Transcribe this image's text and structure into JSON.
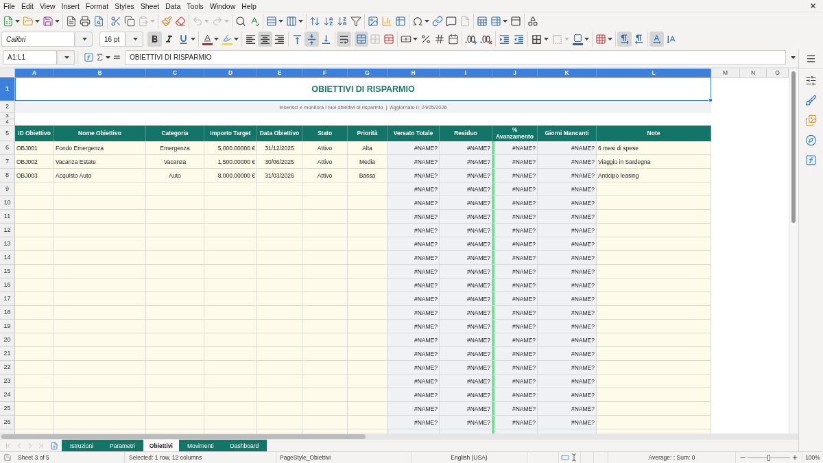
{
  "menu_bar": {
    "items": [
      "File",
      "Edit",
      "View",
      "Insert",
      "Format",
      "Styles",
      "Sheet",
      "Data",
      "Tools",
      "Window",
      "Help"
    ]
  },
  "standard_toolbar": {
    "groups": [
      {
        "buttons": [
          {
            "kind": "new",
            "dropdown": true,
            "disabled": false
          },
          {
            "kind": "open",
            "dropdown": true,
            "disabled": false
          },
          {
            "kind": "save",
            "dropdown": true,
            "disabled": false
          }
        ]
      },
      {
        "buttons": [
          {
            "kind": "pdf",
            "dropdown": false,
            "disabled": false
          },
          {
            "kind": "print",
            "dropdown": false,
            "disabled": false
          },
          {
            "kind": "preview",
            "dropdown": false,
            "disabled": false
          }
        ]
      },
      {
        "buttons": [
          {
            "kind": "cut",
            "dropdown": false,
            "disabled": false
          },
          {
            "kind": "copy",
            "dropdown": false,
            "disabled": false
          },
          {
            "kind": "paste",
            "dropdown": true,
            "disabled": true
          }
        ]
      },
      {
        "buttons": [
          {
            "kind": "clone",
            "dropdown": false,
            "disabled": false
          },
          {
            "kind": "clear",
            "dropdown": false,
            "disabled": false
          }
        ]
      },
      {
        "buttons": [
          {
            "kind": "undo",
            "dropdown": true,
            "disabled": true
          },
          {
            "kind": "redo",
            "dropdown": true,
            "disabled": true
          }
        ]
      },
      {
        "buttons": [
          {
            "kind": "find",
            "dropdown": false,
            "disabled": false
          },
          {
            "kind": "spelling",
            "dropdown": false,
            "disabled": false
          }
        ]
      },
      {
        "buttons": [
          {
            "kind": "rows",
            "dropdown": true,
            "disabled": false
          },
          {
            "kind": "columns",
            "dropdown": true,
            "disabled": false
          }
        ]
      },
      {
        "buttons": [
          {
            "kind": "sort",
            "dropdown": false,
            "disabled": false
          },
          {
            "kind": "ascending",
            "dropdown": false,
            "disabled": false
          },
          {
            "kind": "descending",
            "dropdown": false,
            "disabled": false
          },
          {
            "kind": "autofilter",
            "dropdown": false,
            "disabled": false
          }
        ]
      },
      {
        "buttons": [
          {
            "kind": "image",
            "dropdown": false,
            "disabled": false
          },
          {
            "kind": "chart",
            "dropdown": false,
            "disabled": false
          },
          {
            "kind": "pivot",
            "dropdown": false,
            "disabled": false
          }
        ]
      },
      {
        "buttons": [
          {
            "kind": "symbol",
            "dropdown": true,
            "disabled": false
          },
          {
            "kind": "hyperlink",
            "dropdown": false,
            "disabled": false
          },
          {
            "kind": "comment",
            "dropdown": false,
            "disabled": false
          },
          {
            "kind": "headerfooter",
            "dropdown": false,
            "disabled": true
          }
        ]
      },
      {
        "buttons": [
          {
            "kind": "printarea",
            "dropdown": false,
            "disabled": false
          },
          {
            "kind": "freeze",
            "dropdown": true,
            "disabled": false
          },
          {
            "kind": "split",
            "dropdown": false,
            "disabled": false
          }
        ]
      },
      {
        "buttons": [
          {
            "kind": "shapes",
            "dropdown": false,
            "disabled": false
          }
        ]
      }
    ]
  },
  "formatting_toolbar": {
    "font_name": "Calibri",
    "font_size": "16 pt",
    "groups": [
      {
        "buttons": [
          {
            "kind": "bold",
            "pressed": true,
            "dropdown": false,
            "disabled": false
          },
          {
            "kind": "italic",
            "pressed": false,
            "dropdown": false,
            "disabled": false
          },
          {
            "kind": "underline",
            "pressed": false,
            "dropdown": true,
            "disabled": false
          }
        ]
      },
      {
        "buttons": [
          {
            "kind": "fontcolor",
            "pressed": false,
            "dropdown": true,
            "disabled": false
          },
          {
            "kind": "highlight",
            "pressed": false,
            "dropdown": true,
            "disabled": false
          }
        ]
      },
      {
        "buttons": [
          {
            "kind": "left",
            "pressed": false,
            "dropdown": false,
            "disabled": false
          },
          {
            "kind": "center",
            "pressed": true,
            "dropdown": false,
            "disabled": false
          },
          {
            "kind": "right",
            "pressed": false,
            "dropdown": false,
            "disabled": false
          }
        ]
      },
      {
        "buttons": [
          {
            "kind": "top",
            "pressed": false,
            "dropdown": false,
            "disabled": false
          },
          {
            "kind": "middle",
            "pressed": true,
            "dropdown": false,
            "disabled": false
          },
          {
            "kind": "bottom",
            "pressed": false,
            "dropdown": false,
            "disabled": false
          }
        ]
      },
      {
        "buttons": [
          {
            "kind": "wrap",
            "pressed": true,
            "dropdown": false,
            "disabled": false
          }
        ]
      },
      {
        "buttons": [
          {
            "kind": "mergecenter",
            "pressed": true,
            "dropdown": false,
            "disabled": false
          },
          {
            "kind": "merge",
            "pressed": false,
            "dropdown": false,
            "disabled": true
          },
          {
            "kind": "unmerge",
            "pressed": false,
            "dropdown": false,
            "disabled": false
          }
        ]
      },
      {
        "buttons": [
          {
            "kind": "currency",
            "pressed": false,
            "dropdown": true,
            "disabled": false
          },
          {
            "kind": "percent",
            "pressed": false,
            "dropdown": false,
            "disabled": false
          },
          {
            "kind": "number",
            "pressed": false,
            "dropdown": false,
            "disabled": false
          },
          {
            "kind": "date",
            "pressed": false,
            "dropdown": false,
            "disabled": false
          }
        ]
      },
      {
        "buttons": [
          {
            "kind": "adddecimal",
            "pressed": false,
            "dropdown": false,
            "disabled": false
          },
          {
            "kind": "deletedecimal",
            "pressed": false,
            "dropdown": false,
            "disabled": false
          }
        ]
      },
      {
        "buttons": [
          {
            "kind": "indent",
            "pressed": false,
            "dropdown": false,
            "disabled": false
          },
          {
            "kind": "outdent",
            "pressed": false,
            "dropdown": false,
            "disabled": false
          }
        ]
      },
      {
        "buttons": [
          {
            "kind": "borders",
            "pressed": false,
            "dropdown": true,
            "disabled": false
          },
          {
            "kind": "borderstyle",
            "pressed": false,
            "dropdown": true,
            "disabled": true
          },
          {
            "kind": "bordercolor",
            "pressed": false,
            "dropdown": true,
            "disabled": false
          }
        ]
      },
      {
        "buttons": [
          {
            "kind": "conditional",
            "pressed": false,
            "dropdown": true,
            "disabled": false
          }
        ]
      },
      {
        "buttons": [
          {
            "kind": "ltr",
            "pressed": true,
            "dropdown": false,
            "disabled": false
          },
          {
            "kind": "rtl",
            "pressed": false,
            "dropdown": false,
            "disabled": false
          }
        ]
      },
      {
        "buttons": [
          {
            "kind": "horizontal",
            "pressed": true,
            "dropdown": false,
            "disabled": false
          },
          {
            "kind": "vertical",
            "pressed": false,
            "dropdown": false,
            "disabled": false
          }
        ]
      }
    ]
  },
  "formula_bar": {
    "name_box": "A1:L1",
    "formula": "OBIETTIVI DI RISPARMIO"
  },
  "sheet": {
    "columns": [
      {
        "label": "A",
        "selected": true
      },
      {
        "label": "B",
        "selected": true
      },
      {
        "label": "C",
        "selected": true
      },
      {
        "label": "D",
        "selected": true
      },
      {
        "label": "E",
        "selected": true
      },
      {
        "label": "F",
        "selected": true
      },
      {
        "label": "G",
        "selected": true
      },
      {
        "label": "H",
        "selected": true
      },
      {
        "label": "I",
        "selected": true
      },
      {
        "label": "J",
        "selected": true
      },
      {
        "label": "K",
        "selected": true
      },
      {
        "label": "L",
        "selected": true
      },
      {
        "label": "M",
        "selected": false
      },
      {
        "label": "N",
        "selected": false
      },
      {
        "label": "O",
        "selected": false
      }
    ],
    "rows": [
      {
        "number": "1",
        "kind": "title",
        "selected": true,
        "text": "OBIETTIVI DI RISPARMIO"
      },
      {
        "number": "2",
        "kind": "subtitle",
        "selected": false,
        "text": "Inserisci e monitora i tuoi obiettivi di risparmio  |  Aggiornato il: 24/05/2026"
      },
      {
        "number": "3",
        "kind": "blank",
        "selected": false
      },
      {
        "number": "4",
        "kind": "blank",
        "selected": false
      },
      {
        "number": "5",
        "kind": "header",
        "selected": false,
        "cells": {
          "id": "ID Obiettivo",
          "name": "Nome Obiettivo",
          "category": "Categoria",
          "target_amount": "Importo Target",
          "target_date": "Data Obiettivo",
          "status": "Stato",
          "priority": "Priorità",
          "paid_total": "Versato Totale",
          "remaining": "Residuo",
          "progress": "% Avanzamento",
          "days_left": "Giorni Mancanti",
          "note": "Note"
        }
      },
      {
        "number": "6",
        "kind": "data",
        "selected": false,
        "cells": {
          "id": "OBJ001",
          "name": "Fondo Emergenza",
          "category": "Emergenza",
          "target_amount": "5,000.00000 €",
          "target_date": "31/12/2025",
          "status": "Attivo",
          "priority": "Alta",
          "paid_total": "#NAME?",
          "remaining": "#NAME?",
          "progress": "#NAME?",
          "days_left": "#NAME?",
          "note": "6 mesi di spese"
        }
      },
      {
        "number": "7",
        "kind": "data",
        "selected": false,
        "cells": {
          "id": "OBJ002",
          "name": "Vacanza Estate",
          "category": "Vacanza",
          "target_amount": "1,500.00000 €",
          "target_date": "30/06/2025",
          "status": "Attivo",
          "priority": "Media",
          "paid_total": "#NAME?",
          "remaining": "#NAME?",
          "progress": "#NAME?",
          "days_left": "#NAME?",
          "note": "Viaggio in Sardegna"
        }
      },
      {
        "number": "8",
        "kind": "data",
        "selected": false,
        "cells": {
          "id": "OBJ003",
          "name": "Acquisto Auto",
          "category": "Auto",
          "target_amount": "8,000.00000 €",
          "target_date": "31/03/2026",
          "status": "Attivo",
          "priority": "Bassa",
          "paid_total": "#NAME?",
          "remaining": "#NAME?",
          "progress": "#NAME?",
          "days_left": "#NAME?",
          "note": "Anticipo leasing"
        }
      },
      {
        "number": "9",
        "kind": "data",
        "selected": false,
        "cells": {
          "paid_total": "#NAME?",
          "remaining": "#NAME?",
          "progress": "#NAME?",
          "days_left": "#NAME?"
        }
      },
      {
        "number": "10",
        "kind": "data",
        "selected": false,
        "cells": {
          "paid_total": "#NAME?",
          "remaining": "#NAME?",
          "progress": "#NAME?",
          "days_left": "#NAME?"
        }
      },
      {
        "number": "11",
        "kind": "data",
        "selected": false,
        "cells": {
          "paid_total": "#NAME?",
          "remaining": "#NAME?",
          "progress": "#NAME?",
          "days_left": "#NAME?"
        }
      },
      {
        "number": "12",
        "kind": "data",
        "selected": false,
        "cells": {
          "paid_total": "#NAME?",
          "remaining": "#NAME?",
          "progress": "#NAME?",
          "days_left": "#NAME?"
        }
      },
      {
        "number": "13",
        "kind": "data",
        "selected": false,
        "cells": {
          "paid_total": "#NAME?",
          "remaining": "#NAME?",
          "progress": "#NAME?",
          "days_left": "#NAME?"
        }
      },
      {
        "number": "14",
        "kind": "data",
        "selected": false,
        "cells": {
          "paid_total": "#NAME?",
          "remaining": "#NAME?",
          "progress": "#NAME?",
          "days_left": "#NAME?"
        }
      },
      {
        "number": "15",
        "kind": "data",
        "selected": false,
        "cells": {
          "paid_total": "#NAME?",
          "remaining": "#NAME?",
          "progress": "#NAME?",
          "days_left": "#NAME?"
        }
      },
      {
        "number": "16",
        "kind": "data",
        "selected": false,
        "cells": {
          "paid_total": "#NAME?",
          "remaining": "#NAME?",
          "progress": "#NAME?",
          "days_left": "#NAME?"
        }
      },
      {
        "number": "17",
        "kind": "data",
        "selected": false,
        "cells": {
          "paid_total": "#NAME?",
          "remaining": "#NAME?",
          "progress": "#NAME?",
          "days_left": "#NAME?"
        }
      },
      {
        "number": "18",
        "kind": "data",
        "selected": false,
        "cells": {
          "paid_total": "#NAME?",
          "remaining": "#NAME?",
          "progress": "#NAME?",
          "days_left": "#NAME?"
        }
      },
      {
        "number": "19",
        "kind": "data",
        "selected": false,
        "cells": {
          "paid_total": "#NAME?",
          "remaining": "#NAME?",
          "progress": "#NAME?",
          "days_left": "#NAME?"
        }
      },
      {
        "number": "20",
        "kind": "data",
        "selected": false,
        "cells": {
          "paid_total": "#NAME?",
          "remaining": "#NAME?",
          "progress": "#NAME?",
          "days_left": "#NAME?"
        }
      },
      {
        "number": "21",
        "kind": "data",
        "selected": false,
        "cells": {
          "paid_total": "#NAME?",
          "remaining": "#NAME?",
          "progress": "#NAME?",
          "days_left": "#NAME?"
        }
      },
      {
        "number": "22",
        "kind": "data",
        "selected": false,
        "cells": {
          "paid_total": "#NAME?",
          "remaining": "#NAME?",
          "progress": "#NAME?",
          "days_left": "#NAME?"
        }
      },
      {
        "number": "23",
        "kind": "data",
        "selected": false,
        "cells": {
          "paid_total": "#NAME?",
          "remaining": "#NAME?",
          "progress": "#NAME?",
          "days_left": "#NAME?"
        }
      },
      {
        "number": "24",
        "kind": "data",
        "selected": false,
        "cells": {
          "paid_total": "#NAME?",
          "remaining": "#NAME?",
          "progress": "#NAME?",
          "days_left": "#NAME?"
        }
      },
      {
        "number": "25",
        "kind": "data",
        "selected": false,
        "cells": {
          "paid_total": "#NAME?",
          "remaining": "#NAME?",
          "progress": "#NAME?",
          "days_left": "#NAME?"
        }
      },
      {
        "number": "26",
        "kind": "data",
        "selected": false,
        "cells": {
          "paid_total": "#NAME?",
          "remaining": "#NAME?",
          "progress": "#NAME?",
          "days_left": "#NAME?"
        }
      }
    ]
  },
  "sheet_tabs": [
    {
      "label": "Istruzioni",
      "selected": false
    },
    {
      "label": "Parametri",
      "selected": false
    },
    {
      "label": "Obiettivi",
      "selected": true
    },
    {
      "label": "Movimenti",
      "selected": false
    },
    {
      "label": "Dashboard",
      "selected": false
    }
  ],
  "status_bar": {
    "sheet": "Sheet 3 of 5",
    "selection": "Selected: 1 row, 12 columns",
    "page_style": "PageStyle_Obiettivi",
    "language": "English (USA)",
    "summary": "Average: ; Sum: 0",
    "zoom": {
      "level": 0.5,
      "reading": "100%"
    }
  }
}
